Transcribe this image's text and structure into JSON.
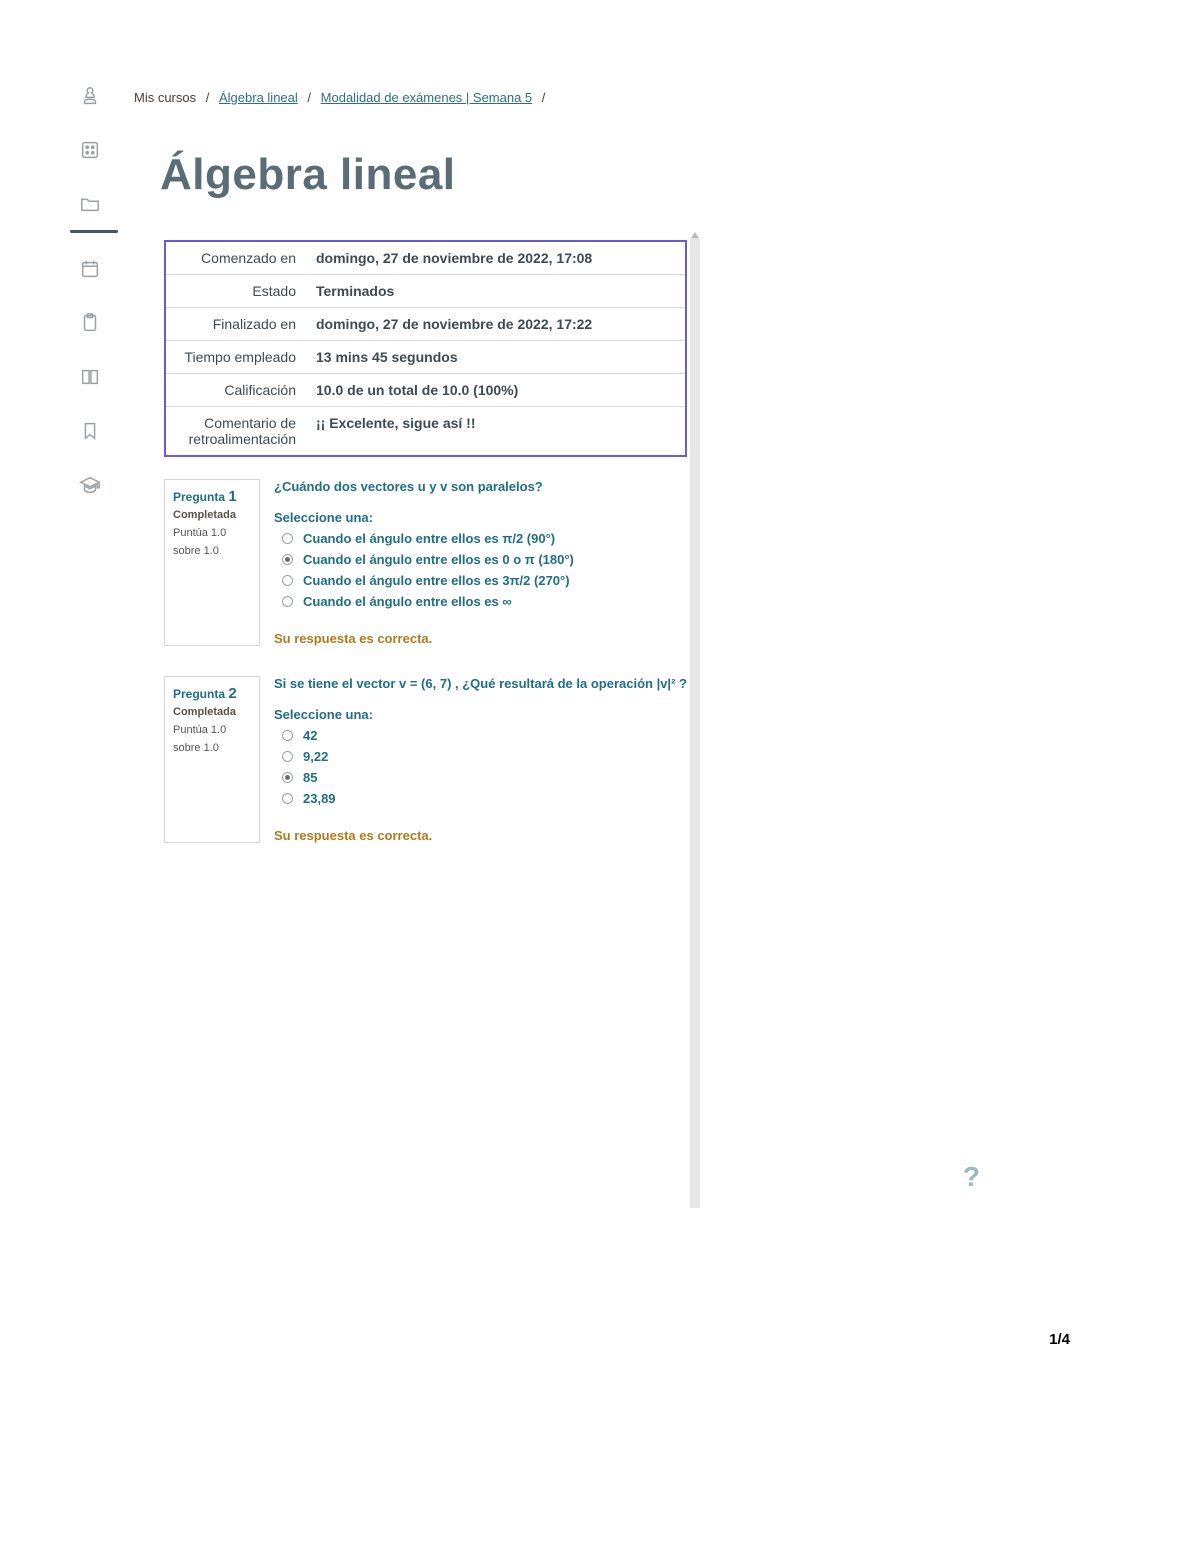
{
  "breadcrumbs": {
    "b1": "Mis cursos",
    "b2": "Álgebra lineal",
    "b3": "Modalidad de exámenes | Semana 5",
    "sep": "/"
  },
  "title": "Álgebra lineal",
  "summary": {
    "l_started": "Comenzado en",
    "v_started": "domingo, 27 de noviembre de 2022, 17:08",
    "l_state": "Estado",
    "v_state": "Terminados",
    "l_finished": "Finalizado en",
    "v_finished": "domingo, 27 de noviembre de 2022, 17:22",
    "l_time": "Tiempo empleado",
    "v_time": "13 mins 45 segundos",
    "l_grade": "Calificación",
    "v_grade": "10.0 de un total de 10.0 (100%)",
    "l_comment": "Comentario de retroalimentación",
    "v_comment": "¡¡ Excelente, sigue así !!"
  },
  "qmeta": {
    "word": "Pregunta",
    "status": "Completada",
    "pts_a": "Puntúa 1.0",
    "pts_b": "sobre 1.0"
  },
  "q1": {
    "num": "1",
    "prompt": "¿Cuándo dos vectores u y v son paralelos?",
    "sel": "Seleccione una:",
    "o1": "Cuando el ángulo entre ellos es π/2 (90°)",
    "o2": "Cuando el ángulo entre ellos es 0 o π (180°)",
    "o3": "Cuando el ángulo entre ellos es 3π/2 (270°)",
    "o4": "Cuando el ángulo entre ellos es ∞",
    "fb": "Su respuesta es correcta."
  },
  "q2": {
    "num": "2",
    "prompt": "Si se tiene el vector v = (6, 7) , ¿Qué resultará de la operación |v|² ?",
    "sel": "Seleccione una:",
    "o1": "42",
    "o2": "9,22",
    "o3": "85",
    "o4": "23,89",
    "fb": "Su respuesta es correcta."
  },
  "footer": {
    "help": "?",
    "page": "1/4"
  }
}
